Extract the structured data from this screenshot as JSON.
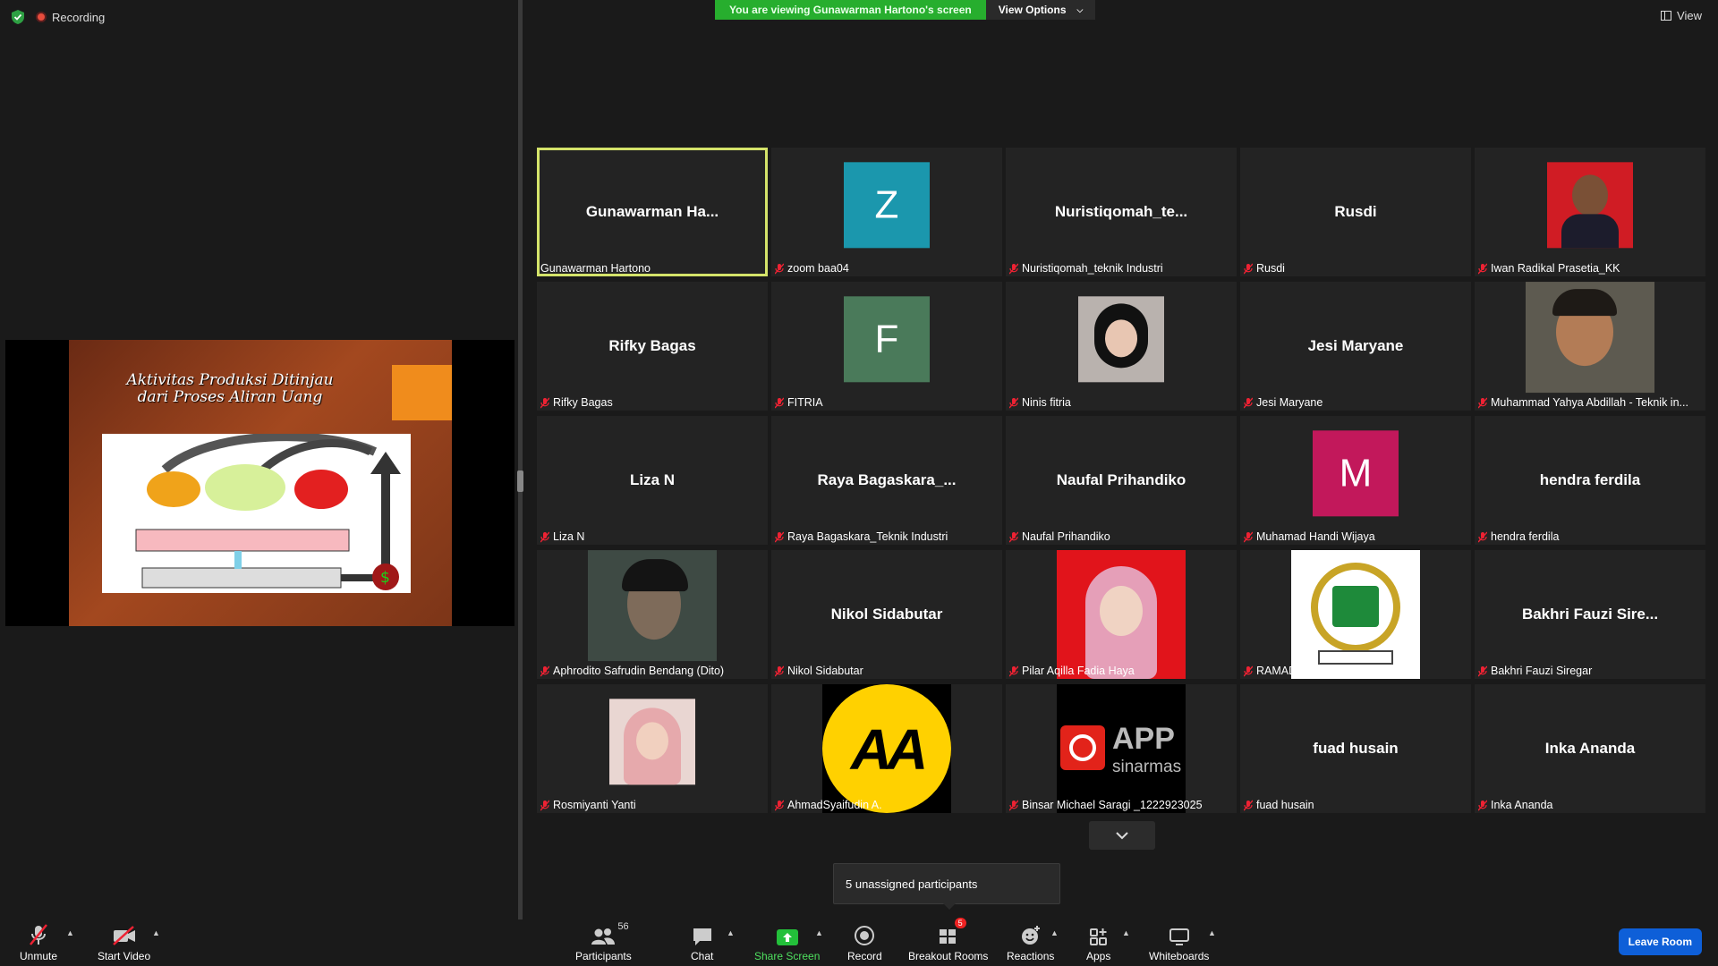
{
  "status": {
    "recording_label": "Recording"
  },
  "banner": {
    "viewing_text": "You are viewing Gunawarman Hartono's screen",
    "view_options_label": "View Options"
  },
  "view": {
    "label": "View"
  },
  "slide": {
    "title_line1": "Aktivitas Produksi Ditinjau",
    "title_line2": "dari Proses Aliran Uang"
  },
  "tiles": [
    {
      "kind": "name",
      "big": "Gunawarman  Ha...",
      "label": "Gunawarman Hartono",
      "active": true,
      "muted": false
    },
    {
      "kind": "avatar",
      "letter": "Z",
      "color": "#1b97ad",
      "label": "zoom baa04",
      "muted": true
    },
    {
      "kind": "name",
      "big": "Nuristiqomah_te...",
      "label": "Nuristiqomah_teknik Industri",
      "muted": true
    },
    {
      "kind": "name",
      "big": "Rusdi",
      "label": "Rusdi",
      "muted": true
    },
    {
      "kind": "photo",
      "photo": "red",
      "label": "Iwan Radikal Prasetia_KK",
      "muted": true
    },
    {
      "kind": "name",
      "big": "Rifky Bagas",
      "label": "Rifky Bagas",
      "muted": true
    },
    {
      "kind": "avatar",
      "letter": "F",
      "color": "#4a7a5a",
      "label": "FITRIA",
      "muted": true
    },
    {
      "kind": "photo",
      "photo": "hijab-grey",
      "label": "Ninis fitria",
      "muted": true
    },
    {
      "kind": "name",
      "big": "Jesi Maryane",
      "label": "Jesi Maryane",
      "muted": true
    },
    {
      "kind": "photo",
      "photo": "selfie",
      "label": "Muhammad Yahya Abdillah - Teknik in...",
      "muted": true
    },
    {
      "kind": "name",
      "big": "Liza N",
      "label": "Liza N",
      "muted": true
    },
    {
      "kind": "name",
      "big": "Raya  Bagaskara_...",
      "label": "Raya Bagaskara_Teknik Industri",
      "muted": true
    },
    {
      "kind": "name",
      "big": "Naufal Prihandiko",
      "label": "Naufal Prihandiko",
      "muted": true
    },
    {
      "kind": "avatar",
      "letter": "M",
      "color": "#c2185b",
      "label": "Muhamad Handi Wijaya",
      "muted": true
    },
    {
      "kind": "name",
      "big": "hendra ferdila",
      "label": "hendra ferdila",
      "muted": true
    },
    {
      "kind": "photo",
      "photo": "dark",
      "label": "Aphrodito Safrudin Bendang (Dito)",
      "muted": true
    },
    {
      "kind": "name",
      "big": "Nikol Sidabutar",
      "label": "Nikol Sidabutar",
      "muted": true
    },
    {
      "kind": "photo",
      "photo": "hijab-red",
      "label": "Pilar Aqilla Fadia Haya",
      "muted": true
    },
    {
      "kind": "photo",
      "photo": "emblem",
      "label": "RAMADHANI FIRMANDA",
      "muted": true
    },
    {
      "kind": "name",
      "big": "Bakhri  Fauzi  Sire...",
      "label": "Bakhri Fauzi Siregar",
      "muted": true
    },
    {
      "kind": "photo",
      "photo": "hijab-pink",
      "label": "Rosmiyanti Yanti",
      "muted": true
    },
    {
      "kind": "photo",
      "photo": "aa",
      "logo_text": "AA",
      "label": "AhmadSyaifudin A.",
      "muted": true
    },
    {
      "kind": "photo",
      "photo": "app",
      "logo_text": "APP",
      "logo_sub": "sinarmas",
      "label": "Binsar Michael Saragi _1222923025",
      "muted": true
    },
    {
      "kind": "name",
      "big": "fuad husain",
      "label": "fuad husain",
      "muted": true
    },
    {
      "kind": "name",
      "big": "Inka Ananda",
      "label": "Inka Ananda",
      "muted": true
    }
  ],
  "unassigned": {
    "text": "5 unassigned participants"
  },
  "toolbar": {
    "unmute": "Unmute",
    "start_video": "Start Video",
    "participants": "Participants",
    "participants_count": "56",
    "chat": "Chat",
    "share_screen": "Share Screen",
    "record": "Record",
    "breakout_rooms": "Breakout Rooms",
    "breakout_badge": "5",
    "reactions": "Reactions",
    "apps": "Apps",
    "whiteboards": "Whiteboards",
    "leave": "Leave Room"
  },
  "colors": {
    "accent_green": "#27ae2e",
    "active_border": "#d4e36a",
    "leave_blue": "#0e5fd8"
  }
}
